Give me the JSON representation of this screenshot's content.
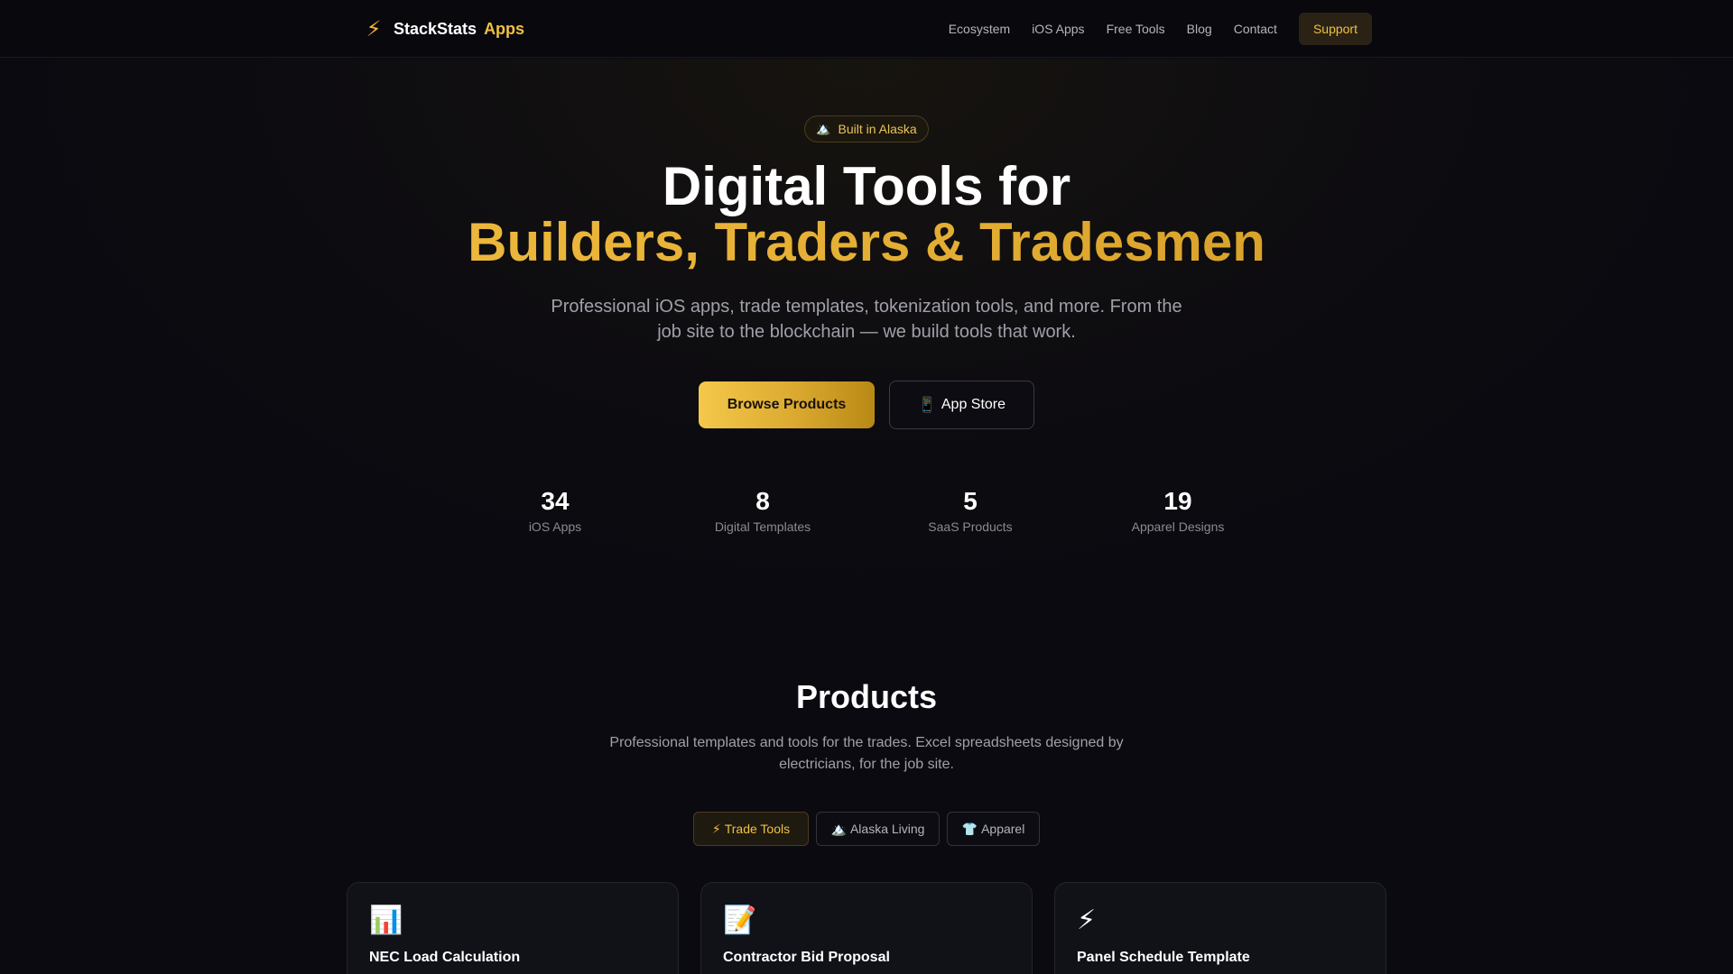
{
  "nav": {
    "brand_icon": "lightning-bolt-icon",
    "brand_name": "StackStats",
    "brand_accent": "Apps",
    "links": [
      {
        "label": "Ecosystem"
      },
      {
        "label": "iOS Apps"
      },
      {
        "label": "Free Tools"
      },
      {
        "label": "Blog"
      },
      {
        "label": "Contact"
      }
    ],
    "support_label": "Support"
  },
  "hero": {
    "badge_icon": "🏔️",
    "badge_label": "Built in Alaska",
    "title_line1": "Digital Tools for",
    "title_line2": "Builders, Traders & Tradesmen",
    "subtitle": "Professional iOS apps, trade templates, tokenization tools, and more. From the job site to the blockchain — we build tools that work.",
    "primary_button": "Browse Products",
    "secondary_button_icon": "📱",
    "secondary_button": "App Store"
  },
  "stats": [
    {
      "value": "34",
      "label": "iOS Apps"
    },
    {
      "value": "8",
      "label": "Digital Templates"
    },
    {
      "value": "5",
      "label": "SaaS Products"
    },
    {
      "value": "19",
      "label": "Apparel Designs"
    }
  ],
  "products": {
    "title": "Products",
    "subtitle": "Professional templates and tools for the trades. Excel spreadsheets designed by electricians, for the job site.",
    "filters": [
      {
        "icon": "⚡",
        "label": "Trade Tools",
        "active": true
      },
      {
        "icon": "🏔️",
        "label": "Alaska Living",
        "active": false
      },
      {
        "icon": "👕",
        "label": "Apparel",
        "active": false
      }
    ],
    "cards": [
      {
        "icon": "📊",
        "title": "NEC Load Calculation"
      },
      {
        "icon": "📝",
        "title": "Contractor Bid Proposal"
      },
      {
        "icon": "⚡",
        "title": "Panel Schedule Template"
      }
    ]
  },
  "colors": {
    "background": "#0a0a10",
    "accent": "#f0c040",
    "muted_text": "#a0a0aa"
  }
}
